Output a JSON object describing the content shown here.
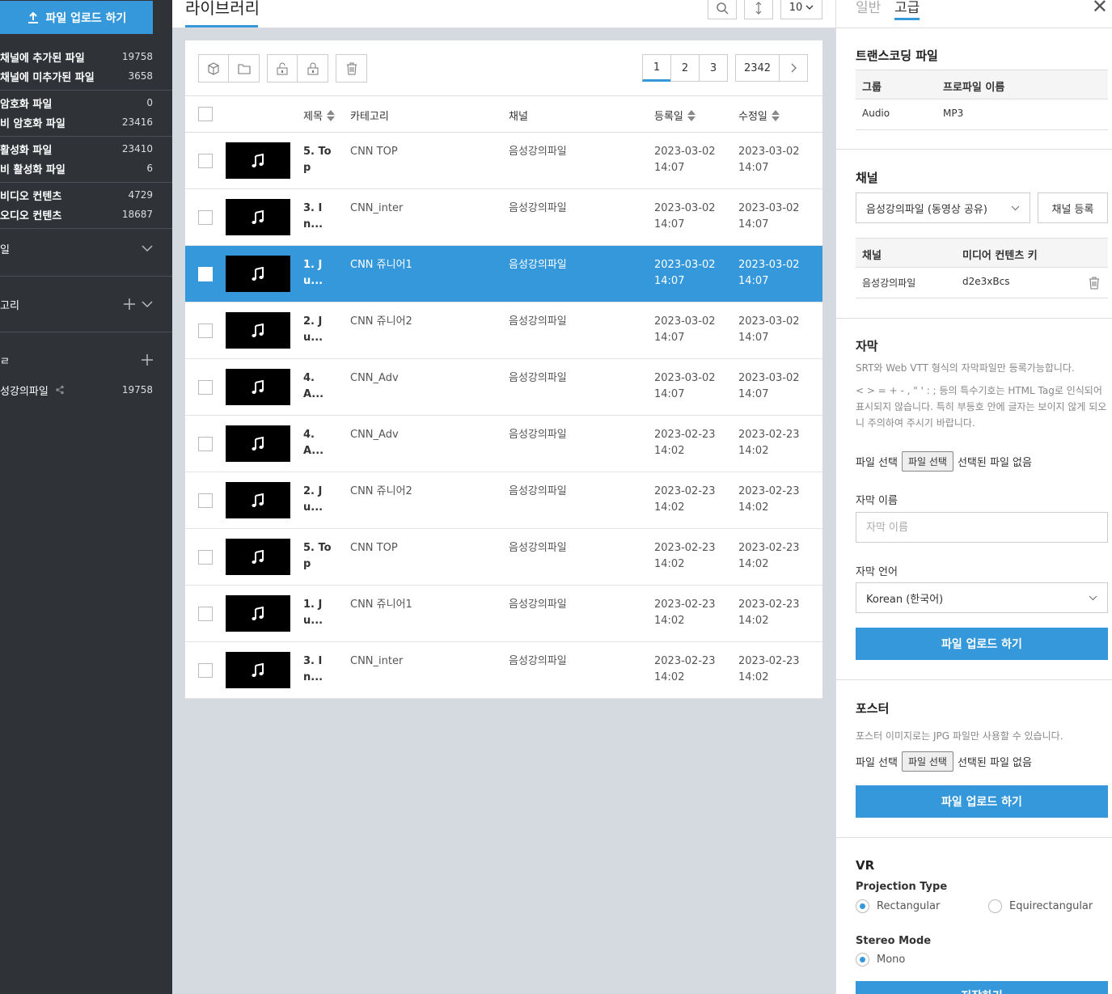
{
  "sidebar": {
    "upload_label": "파일 업로드 하기",
    "rows": [
      {
        "label": "채널에 추가된 파일",
        "count": "19758"
      },
      {
        "label": "채널에 미추가된 파일",
        "count": "3658"
      },
      {
        "label": "암호화 파일",
        "count": "0"
      },
      {
        "label": "비 암호화 파일",
        "count": "23416"
      },
      {
        "label": "활성화 파일",
        "count": "23410"
      },
      {
        "label": "비 활성화 파일",
        "count": "6"
      },
      {
        "label": "비디오 컨텐츠",
        "count": "4729"
      },
      {
        "label": "오디오 컨텐츠",
        "count": "18687"
      }
    ],
    "sections": {
      "file": "일",
      "category": "고리",
      "channel": "ㄹ"
    },
    "channel_item": {
      "label": "성강의파일",
      "count": "19758"
    }
  },
  "header": {
    "title": "라이브러리",
    "page_size": "10"
  },
  "pagination": {
    "pages": [
      "1",
      "2",
      "3"
    ],
    "last": "2342",
    "current": "1"
  },
  "table": {
    "columns": {
      "title": "제목",
      "category": "카테고리",
      "channel": "채널",
      "registered": "등록일",
      "modified": "수정일"
    },
    "rows": [
      {
        "title": "5. Top",
        "category": "CNN TOP",
        "channel": "음성강의파일",
        "reg_date": "2023-03-02",
        "reg_time": "14:07",
        "mod_date": "2023-03-02",
        "mod_time": "14:07",
        "selected": false
      },
      {
        "title": "3. In...",
        "category": "CNN_inter",
        "channel": "음성강의파일",
        "reg_date": "2023-03-02",
        "reg_time": "14:07",
        "mod_date": "2023-03-02",
        "mod_time": "14:07",
        "selected": false
      },
      {
        "title": "1. Ju...",
        "category": "CNN 쥬니어1",
        "channel": "음성강의파일",
        "reg_date": "2023-03-02",
        "reg_time": "14:07",
        "mod_date": "2023-03-02",
        "mod_time": "14:07",
        "selected": true
      },
      {
        "title": "2. Ju...",
        "category": "CNN 쥬니어2",
        "channel": "음성강의파일",
        "reg_date": "2023-03-02",
        "reg_time": "14:07",
        "mod_date": "2023-03-02",
        "mod_time": "14:07",
        "selected": false
      },
      {
        "title": "4. A...",
        "category": "CNN_Adv",
        "channel": "음성강의파일",
        "reg_date": "2023-03-02",
        "reg_time": "14:07",
        "mod_date": "2023-03-02",
        "mod_time": "14:07",
        "selected": false
      },
      {
        "title": "4. A...",
        "category": "CNN_Adv",
        "channel": "음성강의파일",
        "reg_date": "2023-02-23",
        "reg_time": "14:02",
        "mod_date": "2023-02-23",
        "mod_time": "14:02",
        "selected": false
      },
      {
        "title": "2. Ju...",
        "category": "CNN 쥬니어2",
        "channel": "음성강의파일",
        "reg_date": "2023-02-23",
        "reg_time": "14:02",
        "mod_date": "2023-02-23",
        "mod_time": "14:02",
        "selected": false
      },
      {
        "title": "5. Top",
        "category": "CNN TOP",
        "channel": "음성강의파일",
        "reg_date": "2023-02-23",
        "reg_time": "14:02",
        "mod_date": "2023-02-23",
        "mod_time": "14:02",
        "selected": false
      },
      {
        "title": "1. Ju...",
        "category": "CNN 쥬니어1",
        "channel": "음성강의파일",
        "reg_date": "2023-02-23",
        "reg_time": "14:02",
        "mod_date": "2023-02-23",
        "mod_time": "14:02",
        "selected": false
      },
      {
        "title": "3. In...",
        "category": "CNN_inter",
        "channel": "음성강의파일",
        "reg_date": "2023-02-23",
        "reg_time": "14:02",
        "mod_date": "2023-02-23",
        "mod_time": "14:02",
        "selected": false
      }
    ]
  },
  "right": {
    "tabs": {
      "general": "일반",
      "advanced": "고급"
    },
    "transcoding": {
      "title": "트랜스코딩 파일",
      "head_group": "그룹",
      "head_profile": "프로파일 이름",
      "group": "Audio",
      "profile": "MP3"
    },
    "channel": {
      "title": "채널",
      "select_value": "음성강의파일 (동영상 공유)",
      "register_label": "채널 등록",
      "head_channel": "채널",
      "head_key": "미디어 컨텐츠 키",
      "channel_name": "음성강의파일",
      "media_key": "d2e3xBcs"
    },
    "subtitle": {
      "title": "자막",
      "desc1": "SRT와 Web VTT 형식의 자막파일만 등록가능합니다.",
      "desc2": "< > = + - , \" ' : ; 등의 특수기호는 HTML Tag로 인식되어 표시되지 않습니다. 특히 부등호 안에 글자는 보이지 않게 되오니 주의하여 주시기 바랍니다.",
      "file_label": "파일 선택",
      "file_button": "파일 선택",
      "no_file": "선택된 파일 없음",
      "name_label": "자막 이름",
      "name_placeholder": "자막 이름",
      "lang_label": "자막 언어",
      "lang_value": "Korean (한국어)",
      "upload_label": "파일 업로드 하기"
    },
    "poster": {
      "title": "포스터",
      "desc": "포스터 이미지로는 JPG 파일만 사용할 수 있습니다.",
      "file_label": "파일 선택",
      "file_button": "파일 선택",
      "no_file": "선택된 파일 없음",
      "upload_label": "파일 업로드 하기"
    },
    "vr": {
      "title": "VR",
      "projection_label": "Projection Type",
      "opt_rect": "Rectangular",
      "opt_equi": "Equirectangular",
      "stereo_label": "Stereo Mode",
      "opt_mono": "Mono",
      "save_label": "저장하기"
    }
  },
  "colors": {
    "accent": "#3498db",
    "sidebar_bg": "#2f3338",
    "page_bg": "#d5d9e0"
  }
}
